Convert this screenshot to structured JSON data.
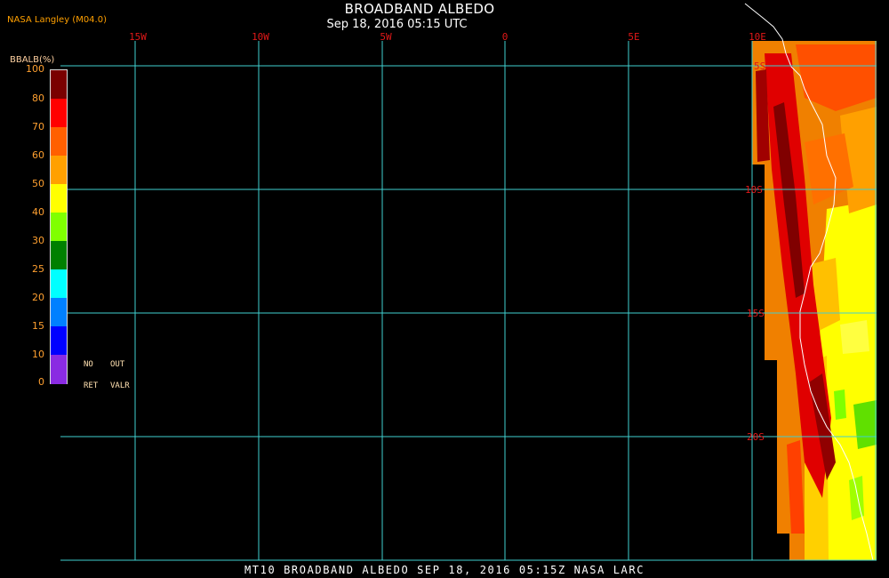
{
  "header": {
    "credit": "NASA Langley (M04.0)",
    "title": "BROADBAND ALBEDO",
    "subtitle": "Sep 18, 2016 05:15 UTC"
  },
  "map": {
    "longitude_labels": [
      "15W",
      "10W",
      "5W",
      "0",
      "5E",
      "10E"
    ],
    "latitude_labels": [
      "5S",
      "10S",
      "15S",
      "20S"
    ]
  },
  "colorbar": {
    "title": "BBALB(%)",
    "tick_labels": [
      "100",
      "80",
      "70",
      "60",
      "50",
      "40",
      "30",
      "25",
      "20",
      "15",
      "10",
      "0"
    ],
    "colors": [
      "#7a0000",
      "#ff0000",
      "#ff6000",
      "#ffa000",
      "#ffff00",
      "#80ff00",
      "#008000",
      "#00ffff",
      "#0080ff",
      "#0000ff",
      "#8a2be2"
    ],
    "no_retrieval": [
      "NO",
      "RET"
    ],
    "out_of_range": [
      "OUT",
      "VALR"
    ]
  },
  "footer": {
    "text": "MT10  BROADBAND ALBEDO  SEP 18, 2016 05:15Z  NASA LARC"
  }
}
